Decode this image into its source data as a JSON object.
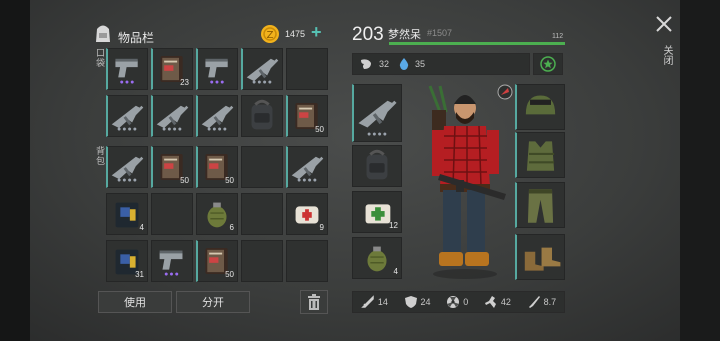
{
  "inventory": {
    "title": "物品栏",
    "coin_amount": "1475",
    "plus_symbol": "+",
    "section_pockets": "口袋",
    "section_backpack": "背包",
    "pockets": [
      {
        "icon": "pistol-icon",
        "dots": "●●●",
        "dot_colors": [
          "#9a6cf0",
          "#9a6cf0",
          "#9a6cf0"
        ]
      },
      {
        "icon": "notebook-icon",
        "count": "23"
      },
      {
        "icon": "pistol-icon",
        "dots": "●●●",
        "dot_colors": [
          "#9a6cf0",
          "#9a6cf0",
          "#9a6cf0"
        ]
      },
      {
        "icon": "rifle-icon",
        "dots": "●●●●",
        "dot_colors": [
          "#9ba3ad",
          "#9ba3ad",
          "#9ba3ad",
          "#9ba3ad"
        ]
      },
      {
        "icon": ""
      },
      {
        "icon": "rifle-icon",
        "dots": "●●●●",
        "dot_colors": [
          "#9ba3ad",
          "#9ba3ad",
          "#9ba3ad",
          "#9ba3ad"
        ]
      },
      {
        "icon": "rifle-icon",
        "dots": "●●●●",
        "dot_colors": [
          "#9ba3ad",
          "#9ba3ad",
          "#9ba3ad",
          "#9ba3ad"
        ]
      },
      {
        "icon": "rifle-icon",
        "dots": "●●●●",
        "dot_colors": [
          "#9ba3ad",
          "#9ba3ad",
          "#9ba3ad",
          "#9ba3ad"
        ]
      },
      {
        "icon": "backpack-icon"
      },
      {
        "icon": "notebook-icon",
        "count": "50"
      }
    ],
    "backpack": [
      {
        "icon": "rifle-icon",
        "dots": "●●●●",
        "dot_colors": [
          "#9ba3ad",
          "#9ba3ad",
          "#9ba3ad",
          "#9ba3ad"
        ]
      },
      {
        "icon": "notebook-icon",
        "count": "50"
      },
      {
        "icon": "notebook-icon",
        "count": "50"
      },
      {
        "icon": ""
      },
      {
        "icon": "rifle-icon",
        "dots": "●●●●",
        "dot_colors": [
          "#9ba3ad",
          "#9ba3ad",
          "#9ba3ad",
          "#9ba3ad"
        ]
      },
      {
        "icon": "ammo-box-icon",
        "count": "4"
      },
      {
        "icon": ""
      },
      {
        "icon": "grenade-icon",
        "count": "6"
      },
      {
        "icon": ""
      },
      {
        "icon": "bandage-icon",
        "count": "9"
      },
      {
        "icon": "ammo-box-icon",
        "count": "31"
      },
      {
        "icon": "pistol-icon",
        "dots": "●●●",
        "dot_colors": [
          "#9a6cf0",
          "#9a6cf0",
          "#9a6cf0"
        ]
      },
      {
        "icon": "notebook-icon",
        "count": "50"
      },
      {
        "icon": ""
      },
      {
        "icon": ""
      }
    ],
    "use_label": "使用",
    "split_label": "分开"
  },
  "player": {
    "level": "203",
    "name": "梦然呆",
    "id": "#1507",
    "hp_value": "112",
    "hp_fraction": 1.0,
    "hunger": "32",
    "thirst": "35",
    "close_label": "关闭"
  },
  "equipment": {
    "left": [
      {
        "icon": "rifle-icon",
        "dots": "●●●●"
      },
      {
        "icon": "backpack-icon"
      },
      {
        "icon": "medkit-icon",
        "count": "12"
      },
      {
        "icon": "grenade-icon",
        "count": "4"
      }
    ],
    "right": [
      {
        "icon": "helmet-icon"
      },
      {
        "icon": "vest-icon"
      },
      {
        "icon": "pants-icon"
      },
      {
        "icon": "boots-icon"
      }
    ]
  },
  "stats": [
    {
      "icon": "sword-icon",
      "value": "14"
    },
    {
      "icon": "shield-icon",
      "value": "24"
    },
    {
      "icon": "radiation-icon",
      "value": "0"
    },
    {
      "icon": "speed-icon",
      "value": "42"
    },
    {
      "icon": "knife-icon",
      "value": "8.7"
    }
  ],
  "colors": {
    "accent": "#56a9a0",
    "hp_bar": "#4caf50",
    "coin": "#f2b21c",
    "star": "#4caf50"
  }
}
